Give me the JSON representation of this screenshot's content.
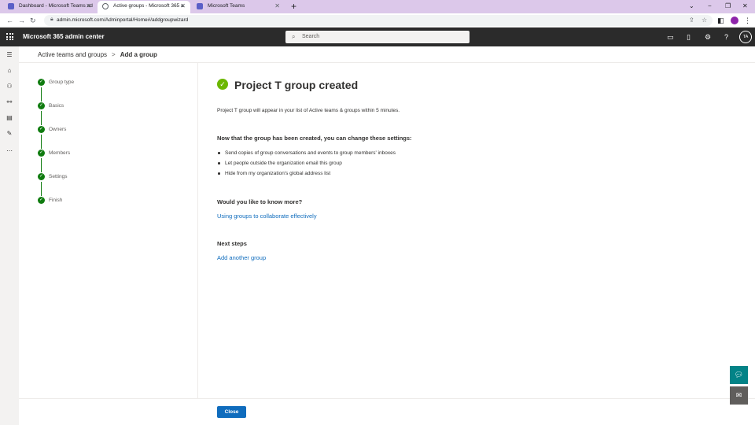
{
  "browser": {
    "tabs": [
      {
        "title": "Dashboard - Microsoft Teams ad",
        "icon": "teams-icon",
        "active": false
      },
      {
        "title": "Active groups - Microsoft 365 a",
        "icon": "globe-icon",
        "active": true
      },
      {
        "title": "Microsoft Teams",
        "icon": "teams-icon",
        "active": false
      }
    ],
    "new_tab": "+",
    "url": "admin.microsoft.com/Adminportal/Home#/addgroupwizard"
  },
  "header": {
    "app_title": "Microsoft 365 admin center",
    "search_placeholder": "Search",
    "avatar_initials": "TA",
    "bar_color": "#2b2b2b"
  },
  "breadcrumb": {
    "parent": "Active teams and groups",
    "separator": ">",
    "current": "Add a group"
  },
  "wizard": {
    "steps": [
      {
        "label": "Group type",
        "status": "complete"
      },
      {
        "label": "Basics",
        "status": "complete"
      },
      {
        "label": "Owners",
        "status": "complete"
      },
      {
        "label": "Members",
        "status": "complete"
      },
      {
        "label": "Settings",
        "status": "complete"
      },
      {
        "label": "Finish",
        "status": "complete"
      }
    ],
    "complete_color": "#107c10"
  },
  "main": {
    "title": "Project T group created",
    "description": "Project T group will appear in your list of Active teams & groups within 5 minutes.",
    "settings_heading": "Now that the group has been created, you can change these settings:",
    "settings_items": [
      "Send copies of group conversations and events to group members' inboxes",
      "Let people outside the organization email this group",
      "Hide from my organization's global address list"
    ],
    "learn_heading": "Would you like to know more?",
    "learn_link": "Using groups to collaborate effectively",
    "next_heading": "Next steps",
    "next_link": "Add another group",
    "success_color": "#6bb700",
    "link_color": "#0f6cbd"
  },
  "footer": {
    "close_label": "Close",
    "button_color": "#0f6cbd"
  }
}
